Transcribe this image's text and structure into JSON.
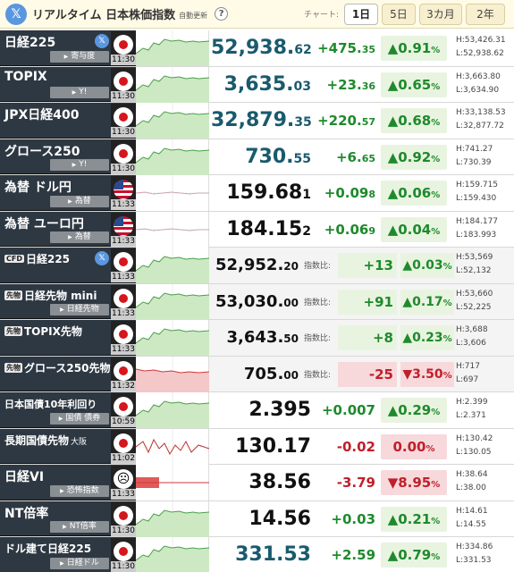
{
  "header": {
    "x_icon": "x-logo-icon",
    "title": "リアルタイム 日本株価指数",
    "auto_refresh": "自動更新",
    "help": "?",
    "chart_label": "チャート:",
    "tabs": [
      {
        "label": "1日",
        "active": true
      },
      {
        "label": "5日",
        "active": false
      },
      {
        "label": "3カ月",
        "active": false
      },
      {
        "label": "2年",
        "active": false
      }
    ]
  },
  "rows": [
    {
      "name": "日経225",
      "sub": "寄与度",
      "x": true,
      "icon": "jp",
      "time": "11:30",
      "price_int": "52,938.",
      "price_dec": "62",
      "teal": true,
      "chg_int": "+475.",
      "chg_dec": "35",
      "dir": "up",
      "pct": "▲0.91",
      "high": "H:53,426.31",
      "low": "L:52,938.62",
      "chart": "up"
    },
    {
      "name": "TOPIX",
      "sub": "Y!",
      "icon": "jp",
      "time": "11:30",
      "price_int": "3,635.",
      "price_dec": "03",
      "teal": true,
      "chg_int": "+23.",
      "chg_dec": "36",
      "dir": "up",
      "pct": "▲0.65",
      "high": "H:3,663.80",
      "low": "L:3,634.90",
      "chart": "up"
    },
    {
      "name": "JPX日経400",
      "sub": "",
      "icon": "jp",
      "time": "11:30",
      "price_int": "32,879.",
      "price_dec": "35",
      "teal": true,
      "chg_int": "+220.",
      "chg_dec": "57",
      "dir": "up",
      "pct": "▲0.68",
      "high": "H:33,138.53",
      "low": "L:32,877.72",
      "chart": "up"
    },
    {
      "name": "グロース250",
      "sub": "Y!",
      "icon": "jp",
      "time": "11:30",
      "price_int": "730.",
      "price_dec": "55",
      "teal": true,
      "chg_int": "+6.",
      "chg_dec": "65",
      "dir": "up",
      "pct": "▲0.92",
      "high": "H:741.27",
      "low": "L:730.39",
      "chart": "up"
    },
    {
      "name": "為替 ドル円",
      "sub": "為替",
      "icon": "us",
      "time": "11:33",
      "price_int": "159.68",
      "price_dec": "1",
      "teal": false,
      "chg_int": "+0.09",
      "chg_dec": "8",
      "dir": "up",
      "pct": "▲0.06",
      "high": "H:159.715",
      "low": "L:159.430",
      "chart": "flat"
    },
    {
      "name": "為替 ユーロ円",
      "sub": "為替",
      "icon": "us",
      "time": "11:33",
      "price_int": "184.15",
      "price_dec": "2",
      "teal": false,
      "chg_int": "+0.06",
      "chg_dec": "9",
      "dir": "up",
      "pct": "▲0.04",
      "high": "H:184.177",
      "low": "L:183.993",
      "chart": "flat"
    }
  ],
  "cfd_rows": [
    {
      "prefix": "CFD",
      "name": "日経225",
      "sub": "",
      "x": true,
      "icon": "jp",
      "time": "11:33",
      "price_int": "52,952.",
      "price_dec": "20",
      "idx_label": "指数比:",
      "diff": "+13",
      "dir": "up",
      "pct": "▲0.03",
      "high": "H:53,569",
      "low": "L:52,132",
      "chart": "up"
    },
    {
      "prefix": "先物",
      "name": "日経先物 mini",
      "sub": "日経先物",
      "icon": "jp",
      "time": "11:33",
      "price_int": "53,030.",
      "price_dec": "00",
      "idx_label": "指数比:",
      "diff": "+91",
      "dir": "up",
      "pct": "▲0.17",
      "high": "H:53,660",
      "low": "L:52,225",
      "chart": "up"
    },
    {
      "prefix": "先物",
      "name": "TOPIX先物",
      "sub": "",
      "icon": "jp",
      "time": "11:33",
      "price_int": "3,643.",
      "price_dec": "50",
      "idx_label": "指数比:",
      "diff": "+8",
      "dir": "up",
      "pct": "▲0.23",
      "high": "H:3,688",
      "low": "L:3,606",
      "chart": "up"
    },
    {
      "prefix": "先物",
      "name": "グロース250先物",
      "sub": "",
      "icon": "jp",
      "time": "11:32",
      "price_int": "705.",
      "price_dec": "00",
      "idx_label": "指数比:",
      "diff": "-25",
      "dir": "down",
      "pct": "▼3.50",
      "high": "H:717",
      "low": "L:697",
      "chart": "down"
    }
  ],
  "bottom_rows": [
    {
      "name": "日本国債10年利回り",
      "small": "smaller",
      "sub": "国債 債券",
      "icon": "jp",
      "time": "10:59",
      "price": "2.395",
      "chg": "+0.007",
      "dir": "up",
      "pct": "▲0.29",
      "high": "H:2.399",
      "low": "L:2.371",
      "chart": "up"
    },
    {
      "name": "長期国債先物",
      "sup": "大阪",
      "small": "small",
      "sub": "",
      "icon": "jp",
      "time": "11:02",
      "price": "130.17",
      "chg": "-0.02",
      "dir": "down",
      "pct": "0.00",
      "high": "H:130.42",
      "low": "L:130.05",
      "chart": "mixed"
    },
    {
      "name": "日経VI",
      "sub": "恐怖指数",
      "icon": "face",
      "time": "11:33",
      "price": "38.56",
      "chg": "-3.79",
      "dir": "down",
      "pct": "▼8.95",
      "high": "H:38.64",
      "low": "L:38.00",
      "chart": "vi"
    },
    {
      "name": "NT倍率",
      "sub": "NT倍率",
      "icon": "jp",
      "time": "11:30",
      "price": "14.56",
      "chg": "+0.03",
      "dir": "up",
      "pct": "▲0.21",
      "high": "H:14.61",
      "low": "L:14.55",
      "chart": "up"
    },
    {
      "name": "ドル建て日経225",
      "small": "small",
      "sub": "日経ドル",
      "icon": "jp",
      "time": "11:30",
      "price": "331.53",
      "teal": true,
      "chg": "+2.59",
      "dir": "up",
      "pct": "▲0.79",
      "high": "H:334.86",
      "low": "L:331.53",
      "chart": "up"
    }
  ],
  "pct_unit": "%",
  "colors": {
    "up": "#1e8a2c",
    "down": "#c0202a",
    "teal": "#1a5a6e",
    "label_bg": "#2e3842"
  }
}
